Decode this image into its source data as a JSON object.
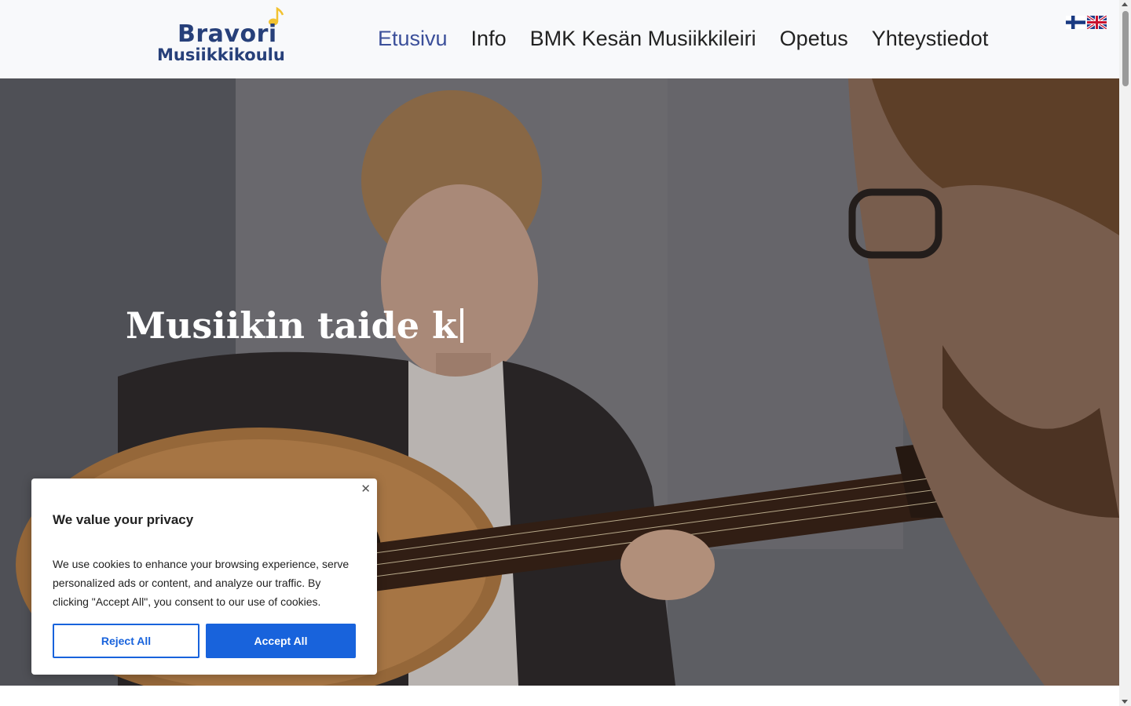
{
  "header": {
    "logo": {
      "line1": "Bravori",
      "line2": "Musiikkikoulu"
    },
    "nav": [
      {
        "label": "Etusivu",
        "active": true
      },
      {
        "label": "Info",
        "active": false
      },
      {
        "label": "BMK Kesän Musiikkileiri",
        "active": false
      },
      {
        "label": "Opetus",
        "active": false
      },
      {
        "label": "Yhteystiedot",
        "active": false
      }
    ],
    "languages": [
      {
        "icon": "finland-flag-icon"
      },
      {
        "icon": "uk-flag-icon"
      }
    ]
  },
  "hero": {
    "title": "Musiikin taide k"
  },
  "cookie_banner": {
    "title": "We value your privacy",
    "text": "We use cookies to enhance your browsing experience, serve personalized ads or content, and analyze our traffic. By clicking \"Accept All\", you consent to our use of cookies.",
    "reject_label": "Reject All",
    "accept_label": "Accept All",
    "close_icon": "close-icon"
  },
  "colors": {
    "brand": "#27407a",
    "nav_active": "#3b4f9a",
    "cookie_accent": "#1863dc"
  }
}
